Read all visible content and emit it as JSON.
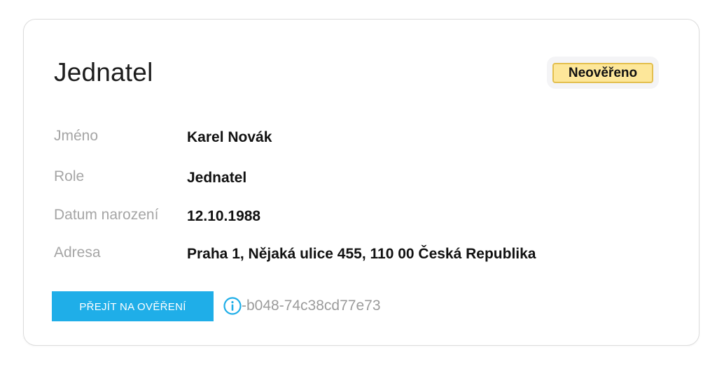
{
  "card": {
    "title": "Jednatel",
    "status_badge": "Neověřeno",
    "fields": [
      {
        "label": "Jméno",
        "value": "Karel Novák"
      },
      {
        "label": "Role",
        "value": "Jednatel"
      },
      {
        "label": "Datum narození",
        "value": "12.10.1988"
      },
      {
        "label": "Adresa",
        "value": "Praha 1, Nějaká ulice 455, 110 00 Česká Republika"
      }
    ],
    "verify_button": "PŘEJÍT NA OVĚŘENÍ",
    "info_id": "-b048-74c38cd77e73",
    "info_icon": "info-circle-icon"
  },
  "colors": {
    "accent": "#1faee8",
    "badge_bg": "#fde79a",
    "badge_border": "#e3bf4e",
    "label": "#a5a5a5"
  }
}
